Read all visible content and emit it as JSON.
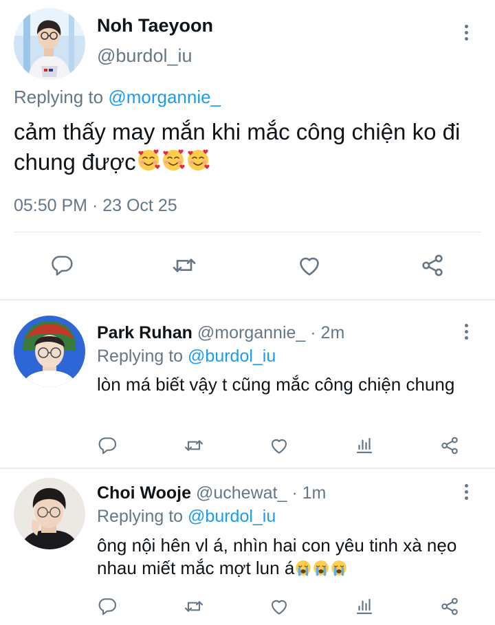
{
  "main_tweet": {
    "name": "Noh Taeyoon",
    "handle": "@burdol_iu",
    "replying_prefix": "Replying to",
    "replying_handle": "@morgannie_",
    "text": "cảm thấy may mắn khi mắc công chiện ko đi chung được",
    "emoji_name": "smiling-face-with-hearts",
    "emoji_count": 3,
    "timestamp": "05:50 PM · 23 Oct 25",
    "actions": [
      "reply",
      "retweet",
      "like",
      "share"
    ]
  },
  "replies": [
    {
      "name": "Park Ruhan",
      "handle": "@morgannie_",
      "time": "· 2m",
      "replying_prefix": "Replying to",
      "replying_handle": "@burdol_iu",
      "text": "lòn má biết vậy t cũng mắc công chiện chung",
      "actions": [
        "reply",
        "retweet",
        "like",
        "analytics",
        "share"
      ]
    },
    {
      "name": "Choi Wooje",
      "handle": "@uchewat_",
      "time": "· 1m",
      "replying_prefix": "Replying to",
      "replying_handle": "@burdol_iu",
      "text": "ông nội hên vl á, nhìn hai con yêu tinh xà nẹo nhau miết mắc mợt lun á",
      "emoji_name": "loudly-crying-face",
      "emoji_count": 3,
      "actions": [
        "reply",
        "retweet",
        "like",
        "analytics",
        "share"
      ]
    }
  ],
  "colors": {
    "text": "#0f1419",
    "muted": "#657786",
    "link": "#1d9bf0",
    "divider": "#e1e8ed"
  }
}
